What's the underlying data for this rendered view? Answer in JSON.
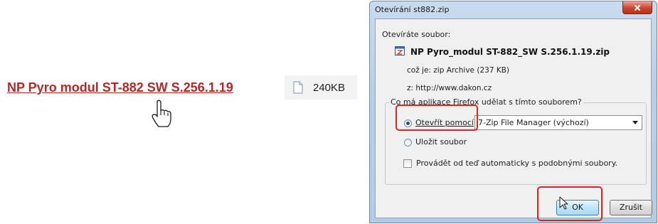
{
  "page": {
    "link_text": "NP Pyro  modul ST-882  SW S.256.1.19",
    "file_size": "240KB"
  },
  "dialog": {
    "title": "Otevírání st882.zip",
    "opening_label": "Otevíráte soubor:",
    "file_name": "NP Pyro_modul ST-882_SW S.256.1.19.zip",
    "what_is": "což je:  zip Archive (237 KB)",
    "from": "z:  http://www.dakon.cz",
    "question": "Co má aplikace Firefox udělat s tímto souborem?",
    "open_with_label": "Otevřít pomocí",
    "open_with_app": "7-Zip File Manager (výchozí)",
    "save_file_label": "Uložit soubor",
    "auto_label": "Provádět od teď automaticky s podobnými soubory.",
    "ok_label": "OK",
    "cancel_label": "Zrušit"
  },
  "colors": {
    "link": "#b02a2a",
    "highlight": "#e0251c",
    "close_button": "#c9452e"
  },
  "icons": [
    "hand-pointer-icon",
    "document-icon",
    "close-icon",
    "zip-file-icon",
    "arrow-cursor-icon"
  ]
}
